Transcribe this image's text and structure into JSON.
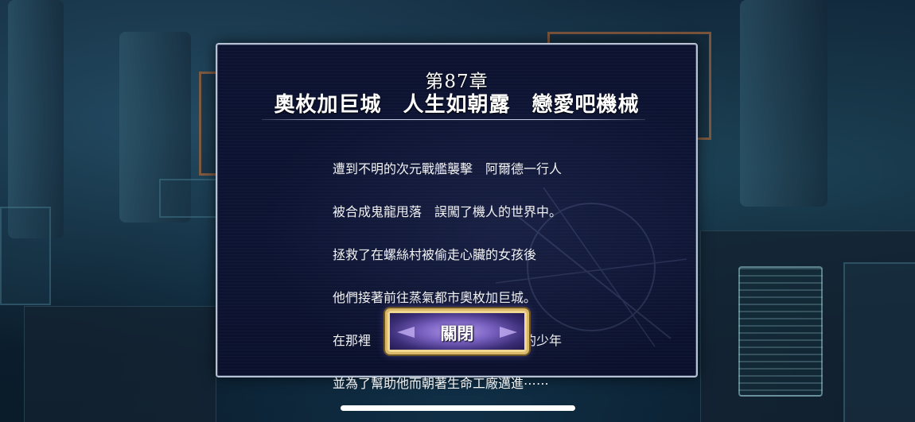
{
  "dialog": {
    "chapter_number": "第87章",
    "chapter_title": "奧枚加巨城　人生如朝露　戀愛吧機械",
    "story_lines": [
      "遭到不明的次元戰艦襲擊　阿爾德一行人",
      "被合成鬼龍甩落　誤闖了機人的世界中。",
      "拯救了在螺絲村被偷走心臟的女孩後",
      "他們接著前往蒸氣都市奧枚加巨城。",
      "在那裡　他們遇到了一名陷入情網的少年",
      "並為了幫助他而朝著生命工廠邁進⋯⋯"
    ],
    "close_label": "關閉"
  },
  "colors": {
    "dialog_border": "#b8c1d3",
    "dialog_background": "#0c1230",
    "button_border": "#d9b86a",
    "button_fill": "#7a62c2"
  }
}
